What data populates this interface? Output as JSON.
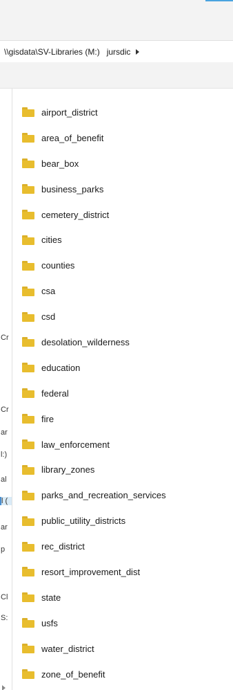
{
  "address_bar": {
    "path_part1": "\\\\gisdata\\SV-Libraries (M:)",
    "path_part2": "jursdic"
  },
  "nav_pane": {
    "fragments": [
      "Cr",
      "Cr",
      "ar",
      "l:)",
      "al",
      "l (",
      "ar",
      "p",
      "Cl",
      "S:"
    ]
  },
  "colors": {
    "folder": "#e8bd2e",
    "selection": "#d9ebf7",
    "accent": "#4a8fd0"
  },
  "folders": [
    {
      "name": "airport_district",
      "icon": "folder-icon"
    },
    {
      "name": "area_of_benefit",
      "icon": "folder-icon"
    },
    {
      "name": "bear_box",
      "icon": "folder-icon"
    },
    {
      "name": "business_parks",
      "icon": "folder-icon"
    },
    {
      "name": "cemetery_district",
      "icon": "folder-icon"
    },
    {
      "name": "cities",
      "icon": "folder-icon"
    },
    {
      "name": "counties",
      "icon": "folder-icon"
    },
    {
      "name": "csa",
      "icon": "folder-icon"
    },
    {
      "name": "csd",
      "icon": "folder-icon"
    },
    {
      "name": "desolation_wilderness",
      "icon": "folder-icon"
    },
    {
      "name": "education",
      "icon": "folder-icon"
    },
    {
      "name": "federal",
      "icon": "folder-icon"
    },
    {
      "name": "fire",
      "icon": "folder-icon"
    },
    {
      "name": "law_enforcement",
      "icon": "folder-icon"
    },
    {
      "name": "library_zones",
      "icon": "folder-icon"
    },
    {
      "name": "parks_and_recreation_services",
      "icon": "folder-icon"
    },
    {
      "name": "public_utility_districts",
      "icon": "folder-icon"
    },
    {
      "name": "rec_district",
      "icon": "folder-icon"
    },
    {
      "name": "resort_improvement_dist",
      "icon": "folder-icon"
    },
    {
      "name": "state",
      "icon": "folder-icon"
    },
    {
      "name": "usfs",
      "icon": "folder-icon"
    },
    {
      "name": "water_district",
      "icon": "folder-icon"
    },
    {
      "name": "zone_of_benefit",
      "icon": "folder-icon"
    }
  ]
}
